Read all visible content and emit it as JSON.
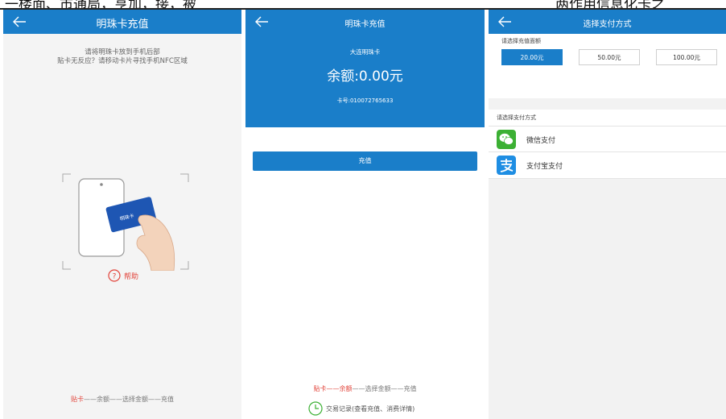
{
  "header_strip": {
    "left_text": "一楼面、市通局，亨加，接，被",
    "right_text": "两作用信息化卡之"
  },
  "panel1": {
    "title": "明珠卡充值",
    "hint_line1": "请将明珠卡放到手机后部",
    "hint_line2": "贴卡无反应？请移动卡片寻找手机NFC区域",
    "card_text": "明珠卡",
    "help_label": "帮助",
    "steps": {
      "step1": "贴卡",
      "rest": "——余额——选择金额——充值"
    }
  },
  "panel2": {
    "title": "明珠卡充值",
    "card_name": "大连明珠卡",
    "balance": "余额:0.00元",
    "card_number": "卡号:010072765633",
    "charge_button": "充值",
    "steps": {
      "step1": "贴卡——余额",
      "rest": "——选择金额——充值"
    },
    "records_label": "交易记录(查看充值、消费详情)"
  },
  "panel3": {
    "title": "选择支付方式",
    "amount_label": "请选择充值面额",
    "amounts": [
      "20.00元",
      "50.00元",
      "100.00元"
    ],
    "selected_amount_index": 0,
    "pay_method_label": "请选择支付方式",
    "methods": [
      {
        "label": "微信支付",
        "icon": "wechat-pay-icon"
      },
      {
        "label": "支付宝支付",
        "icon": "alipay-icon"
      }
    ]
  },
  "colors": {
    "primary": "#1a7ec9",
    "accent_red": "#e2443b",
    "wechat_green": "#3cb034",
    "alipay_blue": "#1f8ee3"
  }
}
